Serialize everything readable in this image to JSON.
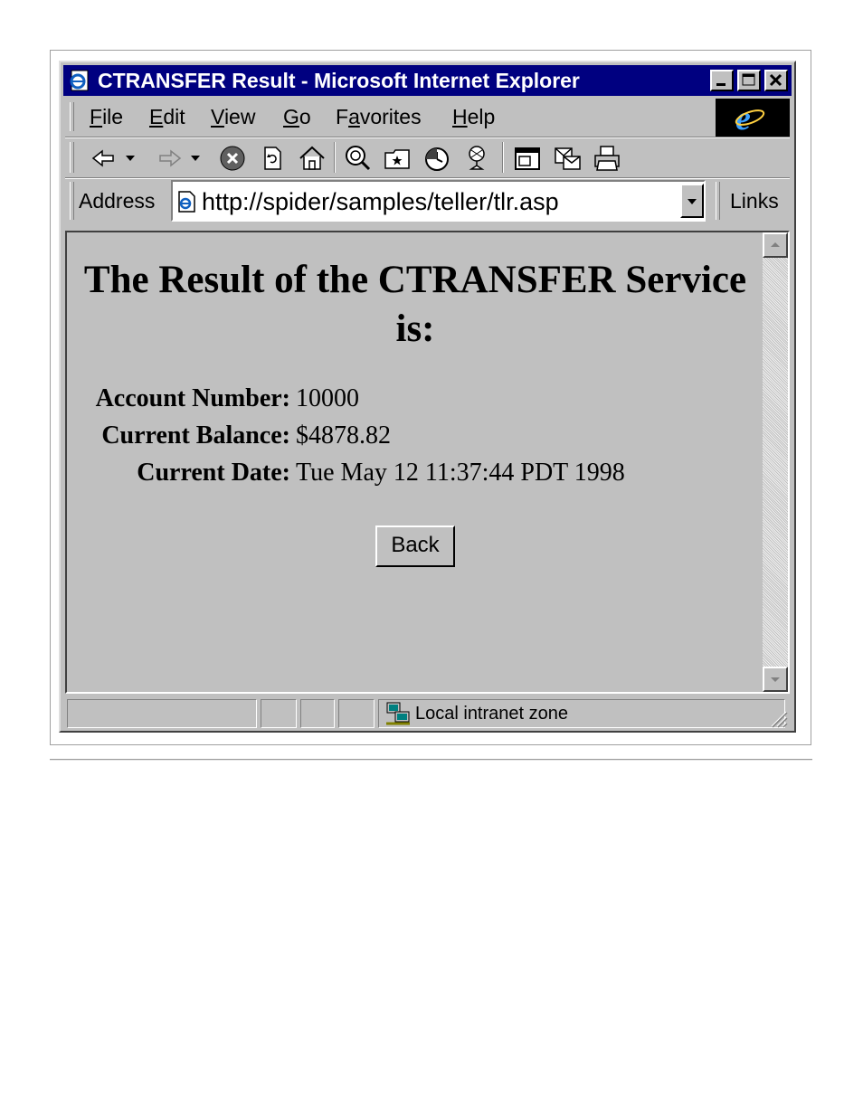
{
  "window": {
    "title": "CTRANSFER Result - Microsoft Internet Explorer",
    "controls": [
      "minimize-icon",
      "maximize-icon",
      "close-icon"
    ]
  },
  "menu": {
    "items": [
      {
        "key": "F",
        "rest": "ile"
      },
      {
        "key": "E",
        "rest": "dit"
      },
      {
        "key": "V",
        "rest": "iew"
      },
      {
        "key": "G",
        "rest": "o"
      },
      {
        "pre": "F",
        "key": "a",
        "rest": "vorites"
      },
      {
        "key": "H",
        "rest": "elp"
      }
    ]
  },
  "toolbar": {
    "icons": [
      "back-arrow-icon",
      "forward-arrow-icon",
      "stop-icon",
      "refresh-icon",
      "home-icon",
      "search-icon",
      "favorites-icon",
      "history-icon",
      "channels-icon",
      "fullscreen-icon",
      "mail-icon",
      "print-icon"
    ]
  },
  "address": {
    "label": "Address",
    "url": "http://spider/samples/teller/tlr.asp",
    "links_label": "Links"
  },
  "page": {
    "heading": "The Result of the CTRANSFER Service is:",
    "fields": [
      {
        "label": "Account Number:",
        "value": "10000"
      },
      {
        "label": "Current Balance:",
        "value": "$4878.82"
      },
      {
        "label": "Current Date:",
        "value": "Tue May 12 11:37:44 PDT 1998"
      }
    ],
    "back_button": "Back"
  },
  "status": {
    "zone": "Local intranet zone"
  }
}
